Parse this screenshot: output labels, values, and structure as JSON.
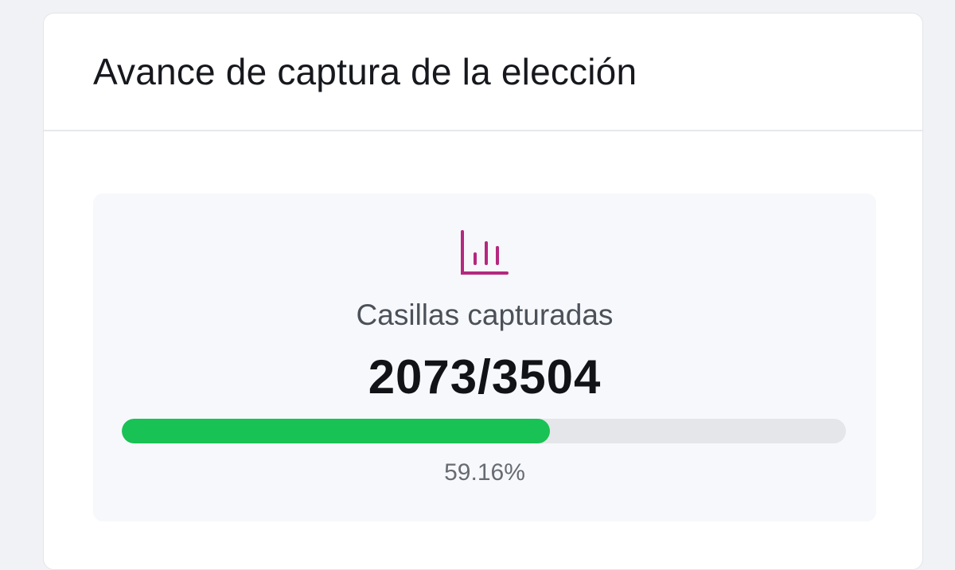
{
  "card": {
    "title": "Avance de captura de la elección"
  },
  "stats": {
    "icon": "bar-chart-icon",
    "icon_color": "#b5277f",
    "label": "Casillas capturadas",
    "value": "2073/3504",
    "progress_percent_text": "59.16%",
    "progress_fraction": 0.5916,
    "progress_color": "#19c254"
  }
}
